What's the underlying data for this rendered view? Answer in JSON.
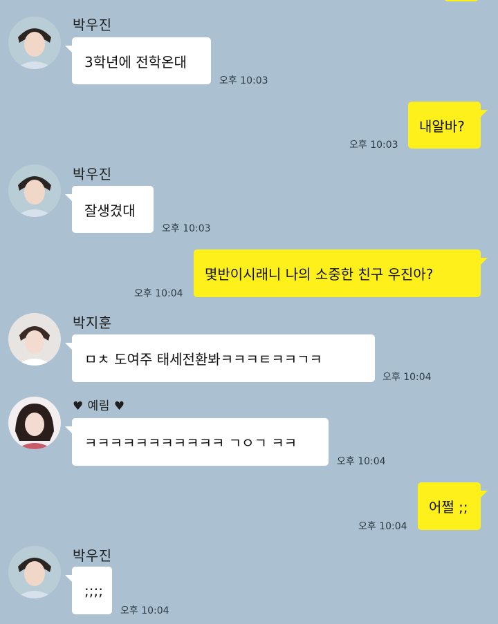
{
  "colors": {
    "background": "#abc1d1",
    "incoming_bubble": "#ffffff",
    "outgoing_bubble": "#fef01b"
  },
  "messages": [
    {
      "sender": "박우진",
      "text": "3학년에 전학온대",
      "time": "오후 10:03",
      "avatar_icon": "profile-photo-icon"
    },
    {
      "text": "내알바?",
      "time": "오후 10:03"
    },
    {
      "sender": "박우진",
      "text": "잘생겼대",
      "time": "오후 10:03",
      "avatar_icon": "profile-photo-icon"
    },
    {
      "text": "몇반이시래니 나의 소중한 친구 우진아?",
      "time": "오후 10:04"
    },
    {
      "sender": "박지훈",
      "text": "ㅁㅊ 도여주 태세전환봐ㅋㅋㅋㅌㅋㅋㄱㅋ",
      "time": "오후 10:04",
      "avatar_icon": "profile-photo-icon"
    },
    {
      "sender": "♥ 예림 ♥",
      "text": "ㅋㅋㅋㅋㅋㅋㅋㅋㅋㅋㅋ ㄱㅇㄱ ㅋㅋ",
      "time": "오후 10:04",
      "avatar_icon": "profile-photo-icon"
    },
    {
      "text": "어쩔 ;;",
      "time": "오후 10:04"
    },
    {
      "sender": "박우진",
      "text": ";;;;",
      "time": "오후 10:04",
      "avatar_icon": "profile-photo-icon"
    }
  ]
}
